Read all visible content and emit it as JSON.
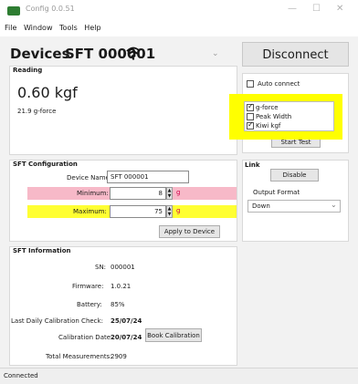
{
  "window": {
    "title": "Config 0.0.51",
    "minimize": "—",
    "maximize": "☐",
    "close": "✕"
  },
  "menu": [
    "File",
    "Window",
    "Tools",
    "Help"
  ],
  "device": {
    "label": "Devices",
    "name": "SFT 000001",
    "disconnect_label": "Disconnect"
  },
  "reading": {
    "title": "Reading",
    "primary": "0.60 kgf",
    "secondary": "21.9 g-force"
  },
  "options": {
    "auto_connect": {
      "label": "Auto connect",
      "checked": false
    },
    "checks": [
      {
        "label": "g-force",
        "checked": true
      },
      {
        "label": "Peak Width",
        "checked": false
      },
      {
        "label": "Kiwi kgf",
        "checked": true
      }
    ],
    "start_test_label": "Start Test"
  },
  "config": {
    "title": "SFT Configuration",
    "device_name_label": "Device Name:",
    "device_name_value": "SFT 000001",
    "minimum_label": "Minimum:",
    "minimum_value": "8",
    "maximum_label": "Maximum:",
    "maximum_value": "75",
    "unit": "g",
    "apply_label": "Apply to Device"
  },
  "link": {
    "title": "Link",
    "disable_label": "Disable",
    "output_format_label": "Output Format",
    "output_format_value": "Down"
  },
  "info": {
    "title": "SFT Information",
    "sn_label": "SN:",
    "sn_value": "000001",
    "firmware_label": "Firmware:",
    "firmware_value": "1.0.21",
    "battery_label": "Battery:",
    "battery_value": "85%",
    "last_cal_label": "Last Daily Calibration Check:",
    "last_cal_value": "25/07/24",
    "cal_date_label": "Calibration Date:",
    "cal_date_value": "20/07/24",
    "book_label": "Book Calibration",
    "total_label": "Total Measurements:",
    "total_value": "2909"
  },
  "status": {
    "text": "Connected"
  },
  "colors": {
    "highlight_yellow": "#ffff00",
    "minimum_pink": "#f7b9c8",
    "maximum_yellow": "#ffff33",
    "app_green": "#2e7d32"
  }
}
